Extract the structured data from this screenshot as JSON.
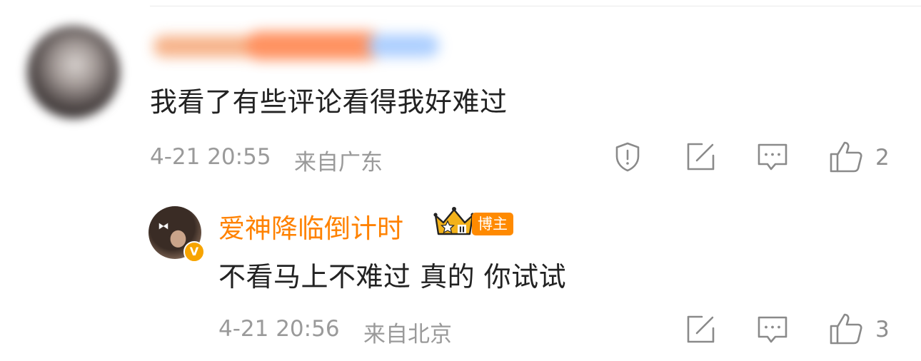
{
  "comment": {
    "username": "",
    "text": "我看了有些评论看得我好难过",
    "time": "4-21 20:55",
    "location": "来自广东",
    "likes": "2"
  },
  "reply": {
    "username": "爱神降临倒计时",
    "badge": "博主",
    "verified_mark": "V",
    "rank_level": "II",
    "text": "不看马上不难过 真的 你试试",
    "time": "4-21 20:56",
    "location": "来自北京",
    "likes": "3"
  },
  "colors": {
    "accent": "#ff8200",
    "meta": "#9a9a9a",
    "icon": "#8a8a8a"
  },
  "icons": [
    "report-icon",
    "repost-icon",
    "comment-icon",
    "like-icon"
  ]
}
